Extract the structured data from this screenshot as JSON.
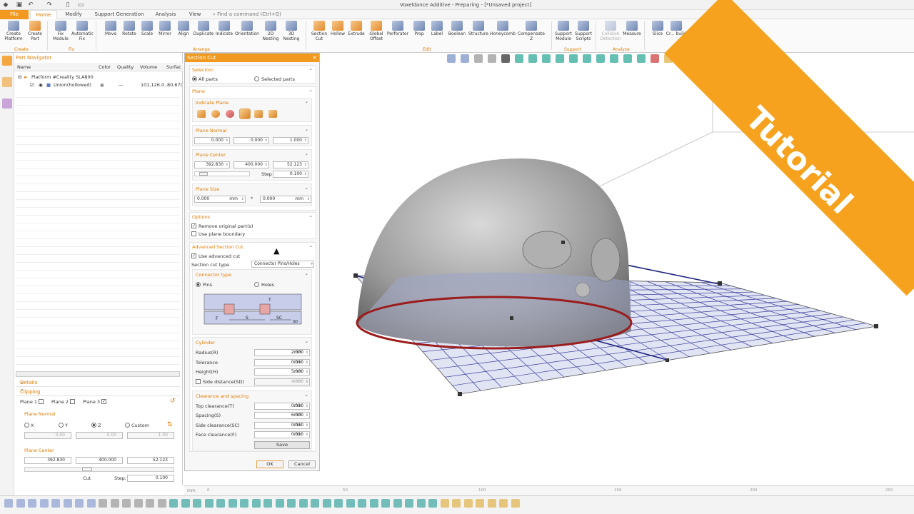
{
  "app": {
    "title": "Voxeldance Additive - Preparing - [*Unsaved project]",
    "quick_access_icons": [
      "save-icon",
      "undo-icon",
      "redo-icon",
      "new-file-icon",
      "open-folder-icon"
    ]
  },
  "menu": {
    "tabs": [
      "File",
      "Home",
      "Modify",
      "Support Generation",
      "Analysis",
      "View"
    ],
    "search_placeholder": "Find a command (Ctrl+Q)"
  },
  "ribbon": {
    "buttons": [
      {
        "label": "Create Platform",
        "group": "Create"
      },
      {
        "label": "Create Part",
        "group": "Create"
      },
      {
        "label": "Fix Module",
        "group": "Fix"
      },
      {
        "label": "Automatic Fix",
        "group": "Fix"
      },
      {
        "label": "Move",
        "group": "Arrange"
      },
      {
        "label": "Rotate",
        "group": "Arrange"
      },
      {
        "label": "Scale",
        "group": "Arrange"
      },
      {
        "label": "Mirror",
        "group": "Arrange"
      },
      {
        "label": "Align",
        "group": "Arrange"
      },
      {
        "label": "Duplicate",
        "group": "Arrange"
      },
      {
        "label": "Indicate",
        "group": "Arrange"
      },
      {
        "label": "Orientation",
        "group": "Arrange"
      },
      {
        "label": "2D Nesting",
        "group": "Arrange"
      },
      {
        "label": "3D Nesting",
        "group": "Arrange"
      },
      {
        "label": "Section Cut",
        "group": "Edit"
      },
      {
        "label": "Hollow",
        "group": "Edit"
      },
      {
        "label": "Extrude",
        "group": "Edit"
      },
      {
        "label": "Global Offset",
        "group": "Edit"
      },
      {
        "label": "Perforator",
        "group": "Edit"
      },
      {
        "label": "Prop",
        "group": "Edit"
      },
      {
        "label": "Label",
        "group": "Edit"
      },
      {
        "label": "Boolean",
        "group": "Edit"
      },
      {
        "label": "Structure",
        "group": "Edit"
      },
      {
        "label": "Honeycomb",
        "group": "Edit"
      },
      {
        "label": "Compensate Z",
        "group": "Edit"
      },
      {
        "label": "Support Module",
        "group": "Support"
      },
      {
        "label": "Support Scripts",
        "group": "Support"
      },
      {
        "label": "Collision Detection",
        "group": "Analyze"
      },
      {
        "label": "Measure",
        "group": "Analyze"
      },
      {
        "label": "Slice",
        "group": ""
      },
      {
        "label": "Cr... build",
        "group": ""
      }
    ],
    "groups": [
      "Create",
      "Fix",
      "Arrange",
      "Edit",
      "Support",
      "Analyze"
    ]
  },
  "navigator": {
    "title": "Part Navigator",
    "columns": [
      "Name",
      "Color",
      "Quality",
      "Volume",
      "Surfac"
    ],
    "rows": [
      {
        "name": "Platform #Creality SLA800",
        "color": "",
        "quality": "",
        "volume": "",
        "surface": ""
      },
      {
        "name": "Union(hollowed)",
        "color": "●",
        "quality": "—",
        "volume": "101,126.0...",
        "surface": "80,67("
      }
    ],
    "details_label": "Details",
    "clipping_label": "Clipping",
    "plane_tabs": [
      "Plane 1",
      "Plane 2",
      "Plane 3"
    ],
    "plane_normal_label": "Plane Normal",
    "axes": [
      "X",
      "Y",
      "Z",
      "Custom"
    ],
    "normal_values": [
      "0.00",
      "0.00",
      "1.00"
    ],
    "plane_center_label": "Plane Center",
    "center_values": [
      "392.830",
      "400.000",
      "52.123"
    ],
    "cut_label": "Cut",
    "step_label": "Step:",
    "step_value": "0.100"
  },
  "section_cut": {
    "title": "Section Cut",
    "selection": {
      "label": "Selection",
      "all": "All parts",
      "selected": "Selected parts"
    },
    "plane": {
      "label": "Plane",
      "indicate_label": "Indicate Plane",
      "normal_label": "Plane Normal",
      "normal_values": [
        "0.000",
        "0.000",
        "1.000"
      ],
      "center_label": "Plane Center",
      "center_values": [
        "392.830",
        "400.000",
        "52.123"
      ],
      "step_label": "Step",
      "step_value": "0.100",
      "size_label": "Plane Size",
      "size_values": [
        "0.000",
        "0.000"
      ],
      "size_unit": "mm",
      "times": "*"
    },
    "options": {
      "label": "Options",
      "remove_original": "Remove original part(s)",
      "use_boundary": "Use plane boundary"
    },
    "advanced": {
      "label": "Advanced Section Cut",
      "use_advanced": "Use advanced cut",
      "type_label": "Section cut type",
      "type_value": "Connector Pins/Holes",
      "connector_label": "Connector type",
      "pins": "Pins",
      "holes": "Holes",
      "diagram_labels": [
        "T",
        "F",
        "S",
        "SC",
        "SD"
      ]
    },
    "cylinder": {
      "label": "Cylinder",
      "fields": [
        {
          "label": "Radius(R)",
          "value": "2.000",
          "unit": "mm"
        },
        {
          "label": "Tolerance",
          "value": "0.010",
          "unit": "mm"
        },
        {
          "label": "Height(H)",
          "value": "5.000",
          "unit": "mm"
        },
        {
          "label": "Side distance(SD)",
          "value": "4.000",
          "unit": "mm"
        }
      ]
    },
    "clearance": {
      "label": "Clearance and spacing",
      "fields": [
        {
          "label": "Top clearance(T)",
          "value": "0.010",
          "unit": "mm"
        },
        {
          "label": "Spacing(S)",
          "value": "6.000",
          "unit": "mm"
        },
        {
          "label": "Side clearance(SC)",
          "value": "0.010",
          "unit": "mm"
        },
        {
          "label": "Face clearance(F)",
          "value": "0.010",
          "unit": "mm"
        }
      ],
      "save": "Save"
    },
    "ok": "OK",
    "cancel": "Cancel"
  },
  "timeline": {
    "unit": "mm",
    "ticks": [
      "0",
      "50",
      "100",
      "150",
      "200",
      "250"
    ]
  },
  "banner": {
    "text": "Tutorial",
    "color": "#f6a21e"
  },
  "colors": {
    "accent": "#f29a1f",
    "plane_grid": "#3a3f9e",
    "cut_outline": "#9b1c1c"
  }
}
